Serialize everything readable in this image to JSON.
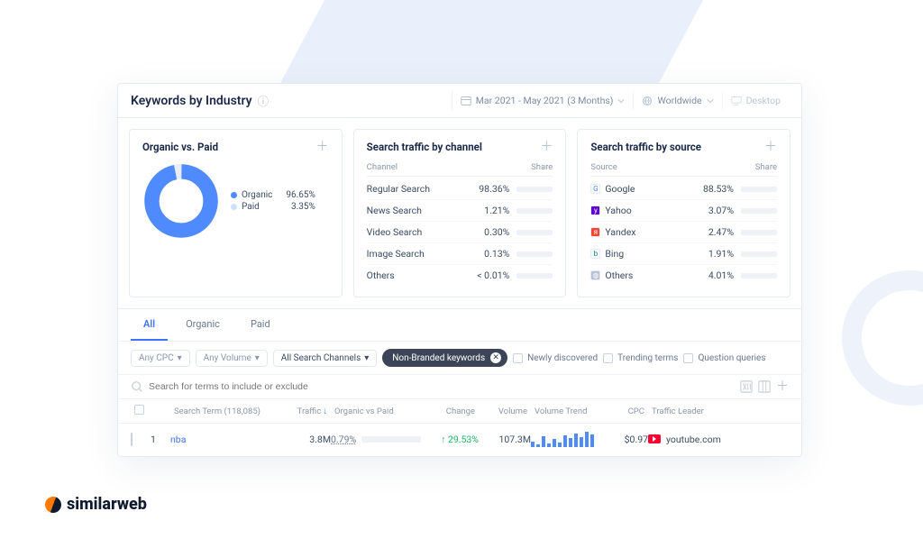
{
  "header": {
    "title": "Keywords by Industry",
    "date_range": "Mar 2021 - May 2021 (3 Months)",
    "region": "Worldwide",
    "device": "Desktop"
  },
  "cards": {
    "ovp": {
      "title": "Organic vs. Paid",
      "organic_label": "Organic",
      "organic_pct": "96.65%",
      "paid_label": "Paid",
      "paid_pct": "3.35%"
    },
    "channel": {
      "title": "Search traffic by channel",
      "col_a": "Channel",
      "col_b": "Share",
      "rows": [
        {
          "label": "Regular Search",
          "value": "98.36%",
          "pct": 98.36
        },
        {
          "label": "News Search",
          "value": "1.21%",
          "pct": 1.21
        },
        {
          "label": "Video Search",
          "value": "0.30%",
          "pct": 0.3
        },
        {
          "label": "Image Search",
          "value": "0.13%",
          "pct": 0.13
        },
        {
          "label": "Others",
          "value": "< 0.01%",
          "pct": 0.01
        }
      ]
    },
    "source": {
      "title": "Search traffic by source",
      "col_a": "Source",
      "col_b": "Share",
      "rows": [
        {
          "label": "Google",
          "value": "88.53%",
          "pct": 88.53,
          "color": "#fff",
          "letter": "G",
          "fg": "#4285f4"
        },
        {
          "label": "Yahoo",
          "value": "3.07%",
          "pct": 3.07,
          "color": "#5f01d1",
          "letter": "y",
          "fg": "#fff"
        },
        {
          "label": "Yandex",
          "value": "2.47%",
          "pct": 2.47,
          "color": "#ff4433",
          "letter": "я",
          "fg": "#fff"
        },
        {
          "label": "Bing",
          "value": "1.91%",
          "pct": 1.91,
          "color": "#fff",
          "letter": "b",
          "fg": "#00809d"
        },
        {
          "label": "Others",
          "value": "4.01%",
          "pct": 4.01,
          "color": "#b6c0d4",
          "letter": "◍",
          "fg": "#fff"
        }
      ]
    }
  },
  "tabs": {
    "all": "All",
    "organic": "Organic",
    "paid": "Paid"
  },
  "filters": {
    "any_cpc": "Any CPC",
    "any_volume": "Any Volume",
    "all_channels": "All Search Channels",
    "non_branded": "Non-Branded keywords",
    "newly_discovered": "Newly discovered",
    "trending": "Trending terms",
    "questions": "Question queries"
  },
  "search": {
    "placeholder": "Search for terms to include or exclude"
  },
  "table": {
    "headers": {
      "term": "Search Term (118,085)",
      "traffic": "Traffic",
      "ovp": "Organic vs Paid",
      "change": "Change",
      "volume": "Volume",
      "trend": "Volume Trend",
      "cpc": "CPC",
      "leader": "Traffic Leader"
    },
    "row": {
      "idx": "1",
      "term": "nba",
      "traffic": "3.8M",
      "ovp_pct": "0.79%",
      "ovp_fill": 62,
      "change": "29.53%",
      "volume": "107.3M",
      "trend": [
        6,
        3,
        12,
        4,
        9,
        5,
        13,
        10,
        15,
        11,
        17,
        14
      ],
      "cpc": "$0.97",
      "leader": "youtube.com"
    }
  },
  "brand": "similarweb",
  "chart_data": {
    "type": "pie",
    "title": "Organic vs. Paid",
    "categories": [
      "Organic",
      "Paid"
    ],
    "values": [
      96.65,
      3.35
    ]
  }
}
